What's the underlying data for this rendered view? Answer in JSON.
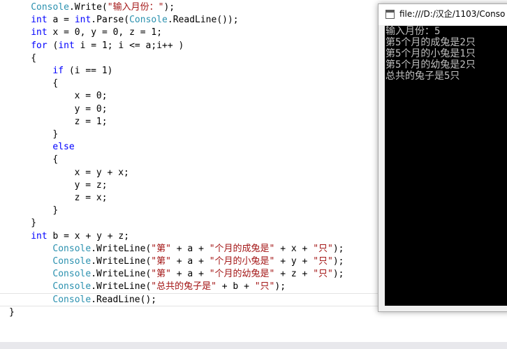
{
  "code": [
    {
      "indent": 4,
      "tokens": [
        {
          "t": "Console",
          "c": "ty"
        },
        {
          "t": ".Write(",
          "c": ""
        },
        {
          "t": "\"输入月份：\"",
          "c": "st"
        },
        {
          "t": ");",
          "c": ""
        }
      ]
    },
    {
      "indent": 4,
      "tokens": [
        {
          "t": "int",
          "c": "kw"
        },
        {
          "t": " a = ",
          "c": ""
        },
        {
          "t": "int",
          "c": "kw"
        },
        {
          "t": ".Parse(",
          "c": ""
        },
        {
          "t": "Console",
          "c": "ty"
        },
        {
          "t": ".ReadLine());",
          "c": ""
        }
      ]
    },
    {
      "indent": 4,
      "tokens": [
        {
          "t": "int",
          "c": "kw"
        },
        {
          "t": " x = 0, y = 0, z = 1;",
          "c": ""
        }
      ]
    },
    {
      "indent": 4,
      "tokens": [
        {
          "t": "for",
          "c": "kw"
        },
        {
          "t": " (",
          "c": ""
        },
        {
          "t": "int",
          "c": "kw"
        },
        {
          "t": " i = 1; i <= a;i++ )",
          "c": ""
        }
      ]
    },
    {
      "indent": 4,
      "tokens": [
        {
          "t": "{",
          "c": ""
        }
      ]
    },
    {
      "indent": 8,
      "tokens": [
        {
          "t": "if",
          "c": "kw"
        },
        {
          "t": " (i == 1)",
          "c": ""
        }
      ]
    },
    {
      "indent": 8,
      "tokens": [
        {
          "t": "{",
          "c": ""
        }
      ]
    },
    {
      "indent": 12,
      "tokens": [
        {
          "t": "x = 0;",
          "c": ""
        }
      ]
    },
    {
      "indent": 12,
      "tokens": [
        {
          "t": "y = 0;",
          "c": ""
        }
      ]
    },
    {
      "indent": 12,
      "tokens": [
        {
          "t": "z = 1;",
          "c": ""
        }
      ]
    },
    {
      "indent": 8,
      "tokens": [
        {
          "t": "}",
          "c": ""
        }
      ]
    },
    {
      "indent": 8,
      "tokens": [
        {
          "t": "else",
          "c": "kw"
        }
      ]
    },
    {
      "indent": 8,
      "tokens": [
        {
          "t": "{",
          "c": ""
        }
      ]
    },
    {
      "indent": 12,
      "tokens": [
        {
          "t": "x = y + x;",
          "c": ""
        }
      ]
    },
    {
      "indent": 12,
      "tokens": [
        {
          "t": "y = z;",
          "c": ""
        }
      ]
    },
    {
      "indent": 12,
      "tokens": [
        {
          "t": "z = x;",
          "c": ""
        }
      ]
    },
    {
      "indent": 8,
      "tokens": [
        {
          "t": "}",
          "c": ""
        }
      ]
    },
    {
      "indent": 4,
      "tokens": [
        {
          "t": "}",
          "c": ""
        }
      ]
    },
    {
      "indent": 4,
      "tokens": [
        {
          "t": "int",
          "c": "kw"
        },
        {
          "t": " b = x + y + z;",
          "c": ""
        }
      ]
    },
    {
      "indent": 8,
      "tokens": [
        {
          "t": "Console",
          "c": "ty"
        },
        {
          "t": ".WriteLine(",
          "c": ""
        },
        {
          "t": "\"第\"",
          "c": "st"
        },
        {
          "t": " + a + ",
          "c": ""
        },
        {
          "t": "\"个月的成兔是\"",
          "c": "st"
        },
        {
          "t": " + x + ",
          "c": ""
        },
        {
          "t": "\"只\"",
          "c": "st"
        },
        {
          "t": ");",
          "c": ""
        }
      ]
    },
    {
      "indent": 8,
      "tokens": [
        {
          "t": "Console",
          "c": "ty"
        },
        {
          "t": ".WriteLine(",
          "c": ""
        },
        {
          "t": "\"第\"",
          "c": "st"
        },
        {
          "t": " + a + ",
          "c": ""
        },
        {
          "t": "\"个月的小兔是\"",
          "c": "st"
        },
        {
          "t": " + y + ",
          "c": ""
        },
        {
          "t": "\"只\"",
          "c": "st"
        },
        {
          "t": ");",
          "c": ""
        }
      ]
    },
    {
      "indent": 8,
      "tokens": [
        {
          "t": "Console",
          "c": "ty"
        },
        {
          "t": ".WriteLine(",
          "c": ""
        },
        {
          "t": "\"第\"",
          "c": "st"
        },
        {
          "t": " + a + ",
          "c": ""
        },
        {
          "t": "\"个月的幼兔是\"",
          "c": "st"
        },
        {
          "t": " + z + ",
          "c": ""
        },
        {
          "t": "\"只\"",
          "c": "st"
        },
        {
          "t": ");",
          "c": ""
        }
      ]
    },
    {
      "indent": 8,
      "tokens": [
        {
          "t": "Console",
          "c": "ty"
        },
        {
          "t": ".WriteLine(",
          "c": ""
        },
        {
          "t": "\"总共的兔子是\"",
          "c": "st"
        },
        {
          "t": " + b + ",
          "c": ""
        },
        {
          "t": "\"只\"",
          "c": "st"
        },
        {
          "t": ");",
          "c": ""
        }
      ]
    },
    {
      "indent": 8,
      "tokens": [
        {
          "t": "Console",
          "c": "ty"
        },
        {
          "t": ".ReadLine();",
          "c": ""
        }
      ]
    },
    {
      "indent": 0,
      "tokens": [
        {
          "t": "}",
          "c": ""
        }
      ]
    }
  ],
  "console": {
    "title": "file:///D:/汉企/1103/Conso",
    "output": [
      "输入月份：5",
      "第5个月的成兔是2只",
      "第5个月的小兔是1只",
      "第5个月的幼兔是2只",
      "总共的兔子是5只"
    ]
  }
}
